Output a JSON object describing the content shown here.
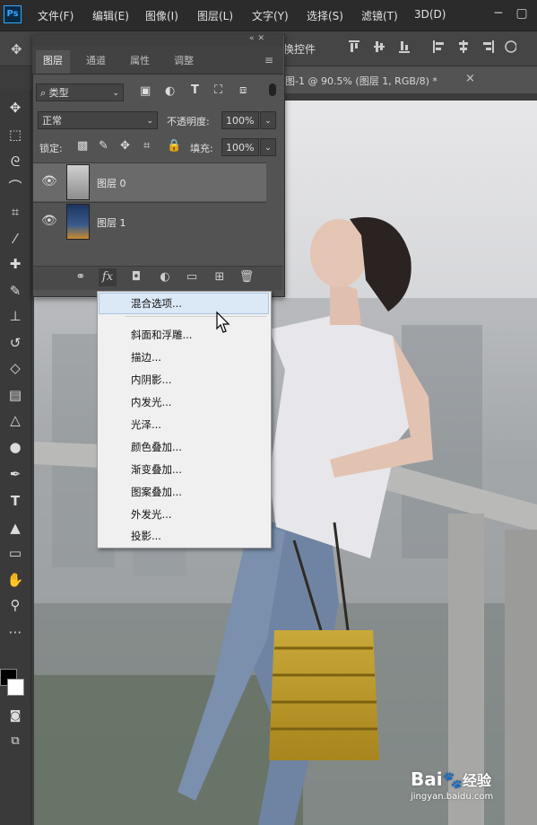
{
  "menubar": {
    "logo": "Ps",
    "items": [
      "文件(F)",
      "编辑(E)",
      "图像(I)",
      "图层(L)",
      "文字(Y)",
      "选择(S)",
      "滤镜(T)",
      "3D(D)"
    ]
  },
  "options_bar": {
    "label": "换控件"
  },
  "document_tab": {
    "title": "图-1 @ 90.5% (图层 1, RGB/8) *",
    "close": "×"
  },
  "layers_panel": {
    "tabs": [
      "图层",
      "通道",
      "属性",
      "调整"
    ],
    "active_tab": "图层",
    "filter_kind": "类型",
    "blend_mode": "正常",
    "opacity_label": "不透明度:",
    "opacity_value": "100%",
    "lock_label": "锁定:",
    "fill_label": "填充:",
    "fill_value": "100%",
    "layers": [
      {
        "name": "图层 0",
        "selected": true
      },
      {
        "name": "图层 1",
        "selected": false
      }
    ],
    "fx_label": "fx"
  },
  "context_menu": {
    "items": [
      "混合选项...",
      "斜面和浮雕...",
      "描边...",
      "内阴影...",
      "内发光...",
      "光泽...",
      "颜色叠加...",
      "渐变叠加...",
      "图案叠加...",
      "外发光...",
      "投影..."
    ],
    "highlighted": "混合选项..."
  },
  "watermark": {
    "brand": "Bai",
    "brand2": "经验",
    "url": "jingyan.baidu.com"
  },
  "colors": {
    "menubar_bg": "#2b2b2b",
    "panel_bg": "#535353",
    "highlight": "#dbe8f6"
  }
}
